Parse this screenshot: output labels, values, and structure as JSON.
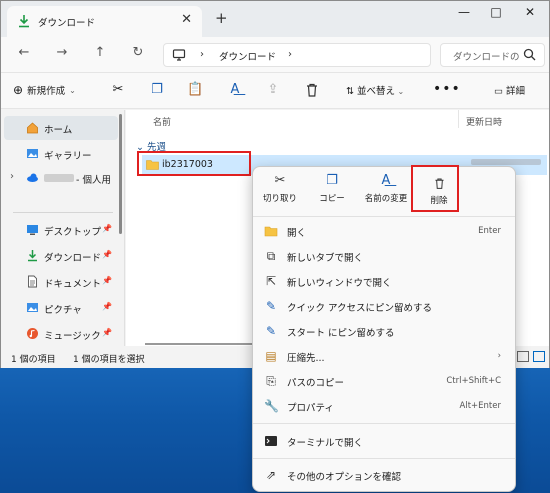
{
  "colors": {
    "accent": "#0067c0",
    "highlight": "#e02020",
    "selection": "#cde8ff",
    "desktop": "#1765b7"
  },
  "window": {
    "tab_title": "ダウンロード",
    "tab_icon": "download-icon",
    "new_tab_symbol": "+",
    "minimize": "—",
    "maximize": "□",
    "close": "✕"
  },
  "address": {
    "path_segment": "ダウンロード",
    "search_placeholder": "ダウンロードの"
  },
  "toolbar": {
    "new_label": "新規作成",
    "sort_label": "並べ替え",
    "more_label": "•••",
    "details_label": "詳細"
  },
  "sidebar": {
    "items": [
      {
        "label": "ホーム",
        "icon": "home-icon"
      },
      {
        "label": "ギャラリー",
        "icon": "gallery-icon"
      },
      {
        "label": "- 個人用",
        "icon": "onedrive-icon"
      },
      {
        "label": "デスクトップ",
        "icon": "desktop-folder-icon"
      },
      {
        "label": "ダウンロード",
        "icon": "download-icon"
      },
      {
        "label": "ドキュメント",
        "icon": "documents-icon"
      },
      {
        "label": "ピクチャ",
        "icon": "pictures-icon"
      },
      {
        "label": "ミュージック",
        "icon": "music-icon"
      }
    ]
  },
  "content": {
    "col_name": "名前",
    "col_date": "更新日時",
    "group_label": "先週",
    "selected_item": "ib2317003"
  },
  "status": {
    "count": "1 個の項目",
    "selected": "1 個の項目を選択"
  },
  "context_menu": {
    "actions": [
      {
        "label": "切り取り",
        "icon": "cut-icon"
      },
      {
        "label": "コピー",
        "icon": "copy-icon"
      },
      {
        "label": "名前の変更",
        "icon": "rename-icon"
      },
      {
        "label": "削除",
        "icon": "delete-icon"
      }
    ],
    "items": [
      {
        "label": "開く",
        "shortcut": "Enter",
        "icon": "folder-open-icon"
      },
      {
        "label": "新しいタブで開く",
        "shortcut": "",
        "icon": "new-tab-icon"
      },
      {
        "label": "新しいウィンドウで開く",
        "shortcut": "",
        "icon": "new-window-icon"
      },
      {
        "label": "クイック アクセスにピン留めする",
        "shortcut": "",
        "icon": "pin-icon"
      },
      {
        "label": "スタート にピン留めする",
        "shortcut": "",
        "icon": "pin-start-icon"
      },
      {
        "label": "圧縮先...",
        "shortcut": "",
        "icon": "zip-icon"
      },
      {
        "label": "パスのコピー",
        "shortcut": "Ctrl+Shift+C",
        "icon": "copy-path-icon"
      },
      {
        "label": "プロパティ",
        "shortcut": "Alt+Enter",
        "icon": "properties-icon"
      },
      {
        "label": "ターミナルで開く",
        "shortcut": "",
        "icon": "terminal-icon"
      },
      {
        "label": "その他のオプションを確認",
        "shortcut": "",
        "icon": "more-options-icon"
      }
    ]
  }
}
